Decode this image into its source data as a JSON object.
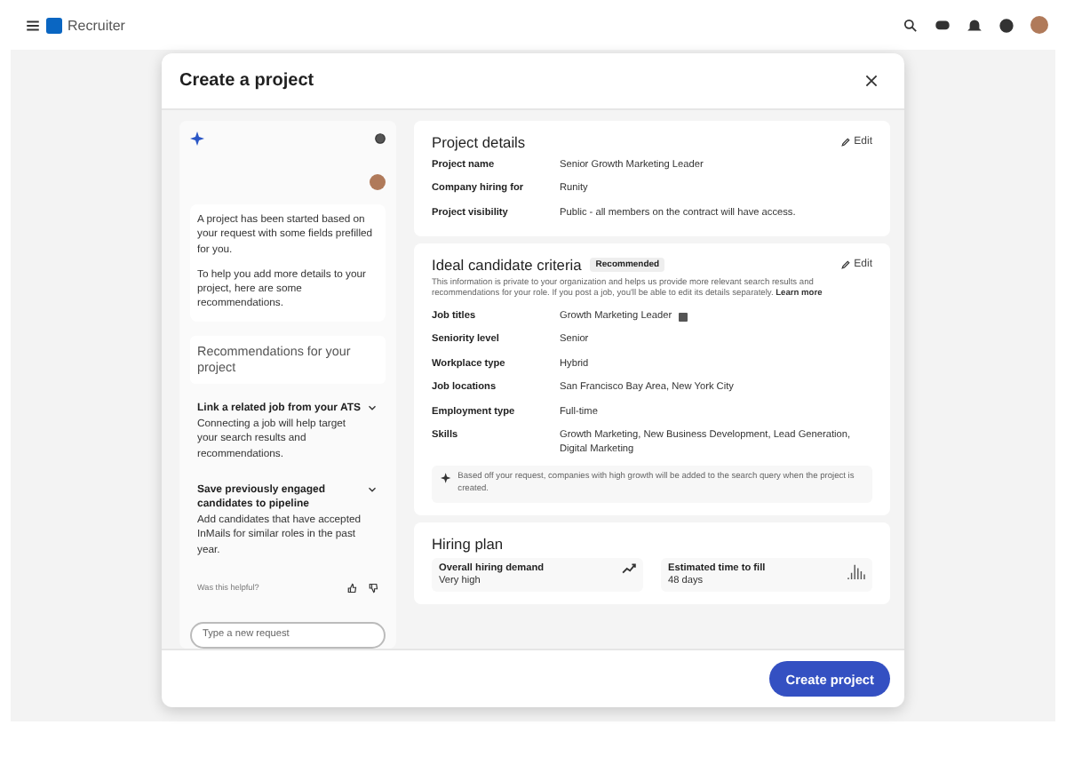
{
  "app": {
    "title": "Recruiter"
  },
  "modal": {
    "title": "Create a project"
  },
  "assistant": {
    "messages": [
      "A project has been started based on your request with some fields prefilled for you.",
      "To help you add more details to your project, here are some recommendations."
    ],
    "recommendations_title": "Recommendations for your project",
    "recommendations": [
      {
        "title": "Link a related job from your ATS",
        "text": "Connecting a job will help target your search results and recommendations."
      },
      {
        "title": "Save previously engaged candidates to pipeline",
        "text": "Add candidates that have accepted InMails for similar roles in the past year."
      }
    ],
    "feedback": "Was this helpful?",
    "input": {
      "placeholder": "Type a new request"
    }
  },
  "project_details": {
    "title": "Project details",
    "edit": "Edit",
    "fields": [
      {
        "label": "Project name",
        "value": "Senior Growth Marketing Leader"
      },
      {
        "label": "Company hiring for",
        "value": "Runity"
      },
      {
        "label": "Project visibility",
        "value": "Public - all members on the contract will have access."
      }
    ]
  },
  "criteria": {
    "title": "Ideal candidate criteria",
    "badge": "Recommended",
    "edit": "Edit",
    "description": "This information is private to your organization and helps us provide more relevant search results and recommendations for your role. If you post a job, you'll be able to edit its details separately.",
    "learn_more": "Learn more",
    "fields": [
      {
        "label": "Job titles",
        "value": "Growth Marketing Leader",
        "kind": "tagged"
      },
      {
        "label": "Seniority level",
        "value": "Senior",
        "kind": "plain"
      },
      {
        "label": "Workplace type",
        "value": "Hybrid",
        "kind": "plain"
      },
      {
        "label": "Job locations",
        "value": "San Francisco Bay Area, New York City",
        "kind": "plain"
      },
      {
        "label": "Employment type",
        "value": "Full-time",
        "kind": "plain"
      },
      {
        "label": "Skills",
        "value": "Growth Marketing, New Business Development, Lead Generation, Digital Marketing",
        "kind": "plain"
      }
    ],
    "note": "Based off your request, companies with high growth will be added to the search query when the project is created."
  },
  "hiring_plan": {
    "title": "Hiring plan",
    "cards": [
      {
        "label": "Overall hiring demand",
        "value": "Very high",
        "kind": "trend"
      },
      {
        "label": "Estimated time to fill",
        "value": "48 days",
        "kind": "bars"
      }
    ]
  },
  "footer": {
    "button": "Create project"
  }
}
